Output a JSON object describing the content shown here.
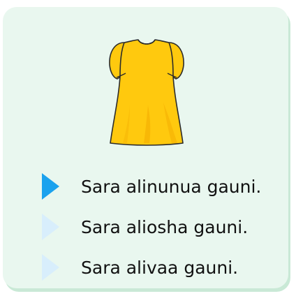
{
  "question": {
    "image_icon": "dress-icon",
    "image_color": "#ffc90e"
  },
  "options": [
    {
      "label": "Sara alinunua gauni.",
      "active": true
    },
    {
      "label": "Sara aliosha gauni.",
      "active": false
    },
    {
      "label": "Sara alivaa gauni.",
      "active": false
    }
  ],
  "colors": {
    "card_background": "#e9f7ef",
    "active_marker": "#1ba2ee",
    "inactive_marker": "#d8eefc"
  }
}
